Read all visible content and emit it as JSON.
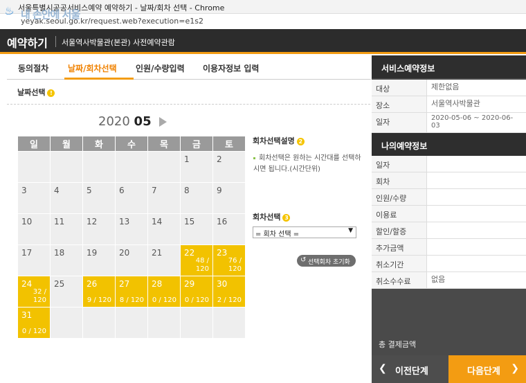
{
  "browser": {
    "title": "서울특별시공공서비스예약 예약하기 - 날짜/회차 선택 - Chrome",
    "url": "yeyak.seoul.go.kr/request.web?execution=e1s2",
    "watermark": "내 손안에 서울"
  },
  "header": {
    "brand": "예약하기",
    "subtitle": "서울역사박물관(본관) 사전예약관람"
  },
  "steps": [
    "동의절차",
    "날짜/회차선택",
    "인원/수량입력",
    "이용자정보 입력"
  ],
  "date_section": {
    "heading": "날짜선택",
    "badge": "!"
  },
  "calendar": {
    "year": "2020",
    "month": "05",
    "weekdays": [
      "일",
      "월",
      "화",
      "수",
      "목",
      "금",
      "토"
    ],
    "weeks": [
      [
        {
          "d": "",
          "c": "",
          "a": false
        },
        {
          "d": "",
          "c": "",
          "a": false
        },
        {
          "d": "",
          "c": "",
          "a": false
        },
        {
          "d": "",
          "c": "",
          "a": false
        },
        {
          "d": "",
          "c": "",
          "a": false
        },
        {
          "d": "1",
          "c": "",
          "a": false
        },
        {
          "d": "2",
          "c": "",
          "a": false
        }
      ],
      [
        {
          "d": "3",
          "c": "",
          "a": false
        },
        {
          "d": "4",
          "c": "",
          "a": false
        },
        {
          "d": "5",
          "c": "",
          "a": false
        },
        {
          "d": "6",
          "c": "",
          "a": false
        },
        {
          "d": "7",
          "c": "",
          "a": false
        },
        {
          "d": "8",
          "c": "",
          "a": false
        },
        {
          "d": "9",
          "c": "",
          "a": false
        }
      ],
      [
        {
          "d": "10",
          "c": "",
          "a": false
        },
        {
          "d": "11",
          "c": "",
          "a": false
        },
        {
          "d": "12",
          "c": "",
          "a": false
        },
        {
          "d": "13",
          "c": "",
          "a": false
        },
        {
          "d": "14",
          "c": "",
          "a": false
        },
        {
          "d": "15",
          "c": "",
          "a": false
        },
        {
          "d": "16",
          "c": "",
          "a": false
        }
      ],
      [
        {
          "d": "17",
          "c": "",
          "a": false
        },
        {
          "d": "18",
          "c": "",
          "a": false
        },
        {
          "d": "19",
          "c": "",
          "a": false
        },
        {
          "d": "20",
          "c": "",
          "a": false
        },
        {
          "d": "21",
          "c": "",
          "a": false
        },
        {
          "d": "22",
          "c": "48 / 120",
          "a": true
        },
        {
          "d": "23",
          "c": "76 / 120",
          "a": true
        }
      ],
      [
        {
          "d": "24",
          "c": "32 / 120",
          "a": true
        },
        {
          "d": "25",
          "c": "",
          "a": false
        },
        {
          "d": "26",
          "c": "9 / 120",
          "a": true
        },
        {
          "d": "27",
          "c": "8 / 120",
          "a": true
        },
        {
          "d": "28",
          "c": "0 / 120",
          "a": true
        },
        {
          "d": "29",
          "c": "0 / 120",
          "a": true
        },
        {
          "d": "30",
          "c": "2 / 120",
          "a": true
        }
      ],
      [
        {
          "d": "31",
          "c": "0 / 120",
          "a": true
        },
        {
          "d": "",
          "c": "",
          "a": false
        },
        {
          "d": "",
          "c": "",
          "a": false
        },
        {
          "d": "",
          "c": "",
          "a": false
        },
        {
          "d": "",
          "c": "",
          "a": false
        },
        {
          "d": "",
          "c": "",
          "a": false
        },
        {
          "d": "",
          "c": "",
          "a": false
        }
      ]
    ]
  },
  "round_info": {
    "heading": "회차선택설명",
    "badge": "2",
    "text": "회차선택은 원하는 시간대를 선택하시면 됩니다.(시간단위)"
  },
  "round_select": {
    "heading": "회차선택",
    "badge": "3",
    "value": "= 회차 선택 ="
  },
  "reset_button": "선택회차 초기화",
  "service_info": {
    "heading": "서비스예약정보",
    "rows": [
      {
        "k": "대상",
        "v": "제한없음"
      },
      {
        "k": "장소",
        "v": "서울역사박물관"
      },
      {
        "k": "일자",
        "v": "2020-05-06 ~ 2020-06-03"
      }
    ]
  },
  "my_info": {
    "heading": "나의예약정보",
    "rows": [
      {
        "k": "일자",
        "v": ""
      },
      {
        "k": "회차",
        "v": ""
      },
      {
        "k": "인원/수량",
        "v": ""
      },
      {
        "k": "이용료",
        "v": ""
      },
      {
        "k": "할인/할증",
        "v": ""
      },
      {
        "k": "추가금액",
        "v": ""
      },
      {
        "k": "취소기간",
        "v": ""
      },
      {
        "k": "취소수수료",
        "v": "없음"
      }
    ]
  },
  "total_label": "총 결제금액",
  "nav": {
    "prev": "이전단계",
    "next": "다음단계"
  },
  "colors": {
    "accent": "#f39c12",
    "available": "#f2c200",
    "dark": "#2c2c2c"
  }
}
